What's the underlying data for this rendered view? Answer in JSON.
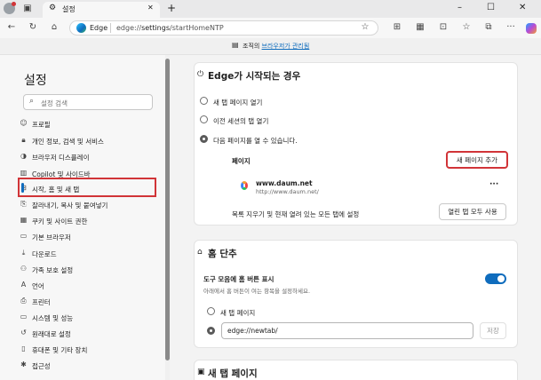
{
  "tab": {
    "title": "설정"
  },
  "address": {
    "site_label": "Edge",
    "url_prefix": "edge://",
    "url_bold": "settings",
    "url_rest": "/startHomeNTP"
  },
  "infobar": {
    "text": "조직의 ",
    "link": "브라우저가 관리됨"
  },
  "sidebar": {
    "title": "설정",
    "search_placeholder": "설정 검색",
    "items": [
      {
        "label": "프로필",
        "icon": "profile-icon",
        "glyph": "☺"
      },
      {
        "label": "개인 정보, 검색 및 서비스",
        "icon": "lock-icon",
        "glyph": "🔒︎"
      },
      {
        "label": "브라우저 디스플레이",
        "icon": "appearance-icon",
        "glyph": "◑"
      },
      {
        "label": "Copilot 및 사이드바",
        "icon": "sidebar-icon",
        "glyph": "▥"
      },
      {
        "label": "시작, 홈 및 새 탭",
        "icon": "start-home-icon",
        "glyph": "⊟"
      },
      {
        "label": "잘라내기, 복사 및 붙여넣기",
        "icon": "clipboard-icon",
        "glyph": "⎘"
      },
      {
        "label": "쿠키 및 사이트 권한",
        "icon": "cookie-icon",
        "glyph": "▦"
      },
      {
        "label": "기본 브라우저",
        "icon": "browser-icon",
        "glyph": "▭"
      },
      {
        "label": "다운로드",
        "icon": "download-icon",
        "glyph": "⤓"
      },
      {
        "label": "가족 보호 설정",
        "icon": "family-icon",
        "glyph": "⚇"
      },
      {
        "label": "언어",
        "icon": "language-icon",
        "glyph": "A"
      },
      {
        "label": "프린터",
        "icon": "printer-icon",
        "glyph": "⎙"
      },
      {
        "label": "시스템 및 성능",
        "icon": "system-icon",
        "glyph": "▭"
      },
      {
        "label": "원래대로 설정",
        "icon": "reset-icon",
        "glyph": "↺"
      },
      {
        "label": "휴대폰 및 기타 장치",
        "icon": "phone-icon",
        "glyph": "▯"
      },
      {
        "label": "접근성",
        "icon": "accessibility-icon",
        "glyph": "✱"
      }
    ]
  },
  "startup": {
    "title": "Edge가 시작되는 경우",
    "options": [
      "새 탭 페이지 열기",
      "이전 세션의 탭 열기",
      "다음 페이지를 열 수 있습니다."
    ],
    "pages_label": "페이지",
    "add_page_button": "새 페이지 추가",
    "page_entry": {
      "name": "www.daum.net",
      "url": "http://www.daum.net/",
      "more": "···"
    },
    "clear_text": "목록 지우기 및 현재 열려 있는 모든 탭에 설정",
    "use_tabs_button": "열린 탭 모두 사용"
  },
  "home": {
    "title": "홈 단추",
    "toggle_label": "도구 모음에 홈 버튼 표시",
    "toggle_desc": "아래에서 홈 버튼이 여는 항목을 설정하세요.",
    "toggle_on": true,
    "option_newtab": "새 탭 페이지",
    "url_value": "edge://newtab/",
    "save_button": "저장"
  },
  "newtab": {
    "title": "새 탭 페이지"
  },
  "colors": {
    "accent": "#0f6cbd",
    "highlight": "#d13438"
  }
}
